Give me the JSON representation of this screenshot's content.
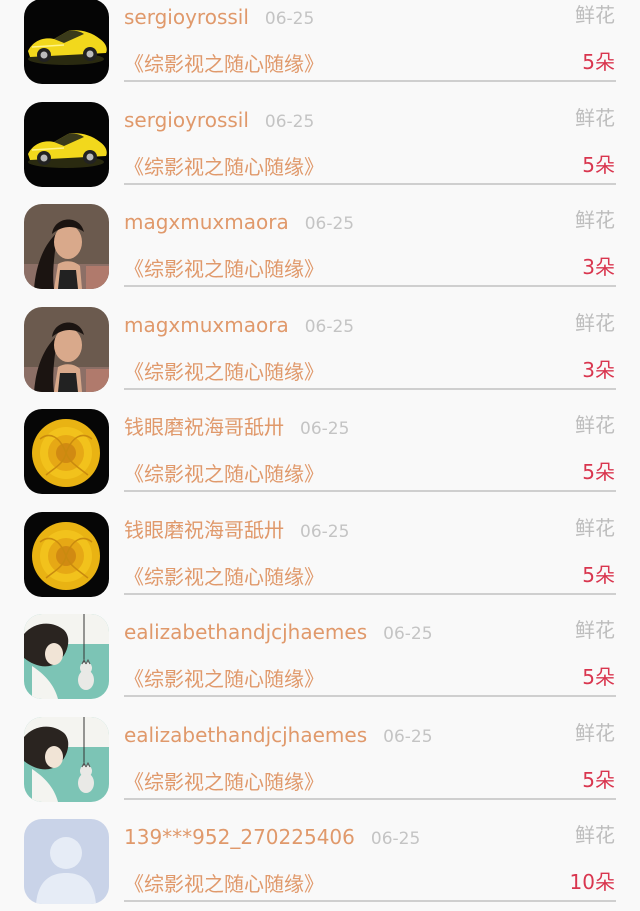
{
  "items": [
    {
      "user": "sergioyrossil",
      "date": "06-25",
      "gift": "鲜花",
      "title": "《综影视之随心随缘》",
      "count": "5朵",
      "avatar": "car-avatar"
    },
    {
      "user": "sergioyrossil",
      "date": "06-25",
      "gift": "鲜花",
      "title": "《综影视之随心随缘》",
      "count": "5朵",
      "avatar": "car-avatar"
    },
    {
      "user": "magxmuxmaora",
      "date": "06-25",
      "gift": "鲜花",
      "title": "《综影视之随心随缘》",
      "count": "3朵",
      "avatar": "woman-photo-avatar"
    },
    {
      "user": "magxmuxmaora",
      "date": "06-25",
      "gift": "鲜花",
      "title": "《综影视之随心随缘》",
      "count": "3朵",
      "avatar": "woman-photo-avatar"
    },
    {
      "user": "钱眼磨祝海哥舐卅",
      "date": "06-25",
      "gift": "鲜花",
      "title": "《综影视之随心随缘》",
      "count": "5朵",
      "avatar": "yellow-rose-avatar"
    },
    {
      "user": "钱眼磨祝海哥舐卅",
      "date": "06-25",
      "gift": "鲜花",
      "title": "《综影视之随心随缘》",
      "count": "5朵",
      "avatar": "yellow-rose-avatar"
    },
    {
      "user": "ealizabethandjcjhaemes",
      "date": "06-25",
      "gift": "鲜花",
      "title": "《综影视之随心随缘》",
      "count": "5朵",
      "avatar": "illustration-avatar"
    },
    {
      "user": "ealizabethandjcjhaemes",
      "date": "06-25",
      "gift": "鲜花",
      "title": "《综影视之随心随缘》",
      "count": "5朵",
      "avatar": "illustration-avatar"
    },
    {
      "user": "139***952_270225406",
      "date": "06-25",
      "gift": "鲜花",
      "title": "《综影视之随心随缘》",
      "count": "10朵",
      "avatar": "default-person-avatar"
    }
  ],
  "colors": {
    "accent": "#e0996b",
    "count": "#d9364f",
    "muted": "#bdbdbd",
    "background": "#f9f9f9"
  }
}
